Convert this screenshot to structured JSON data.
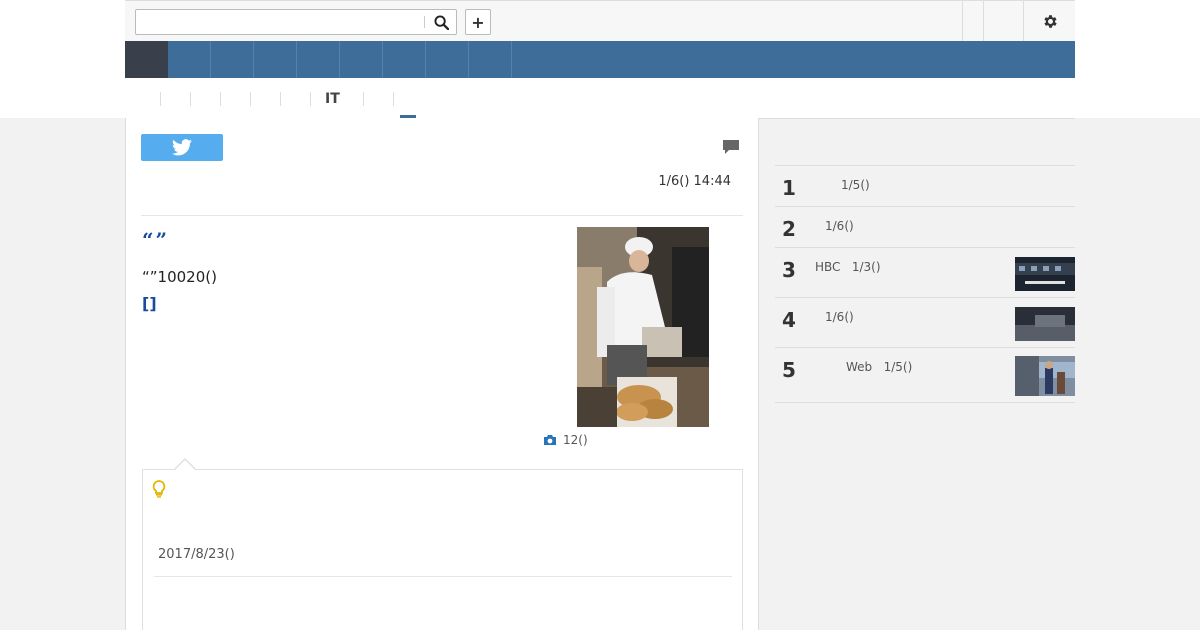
{
  "header": {
    "search_placeholder": "",
    "search_icon": "search-icon",
    "add_label": "+",
    "settings_icon": "gear-icon"
  },
  "nav": {
    "items": [
      "",
      "",
      "",
      "",
      "",
      "",
      "",
      "",
      ""
    ]
  },
  "subnav": {
    "it_label": "IT"
  },
  "article": {
    "tweet_icon": "twitter-icon",
    "comment_icon": "comment-icon",
    "timestamp": "1/6() 14:44",
    "headline": "“”",
    "body": "“”10020()",
    "more_link": "[]",
    "photo_count": "12()"
  },
  "tip": {
    "icon": "lightbulb-icon",
    "date": "2017/8/23()"
  },
  "ranking": [
    {
      "rank": "1",
      "text": "1/5()"
    },
    {
      "rank": "2",
      "text": "1/6()"
    },
    {
      "rank": "3",
      "text": "HBC   1/3()"
    },
    {
      "rank": "4",
      "text": "1/6()"
    },
    {
      "rank": "5",
      "text": "Web   1/5()"
    }
  ],
  "colors": {
    "nav_bg": "#3f6d99",
    "nav_active": "#3a3f4c",
    "headline": "#1a4aa0",
    "twitter": "#55acee"
  }
}
